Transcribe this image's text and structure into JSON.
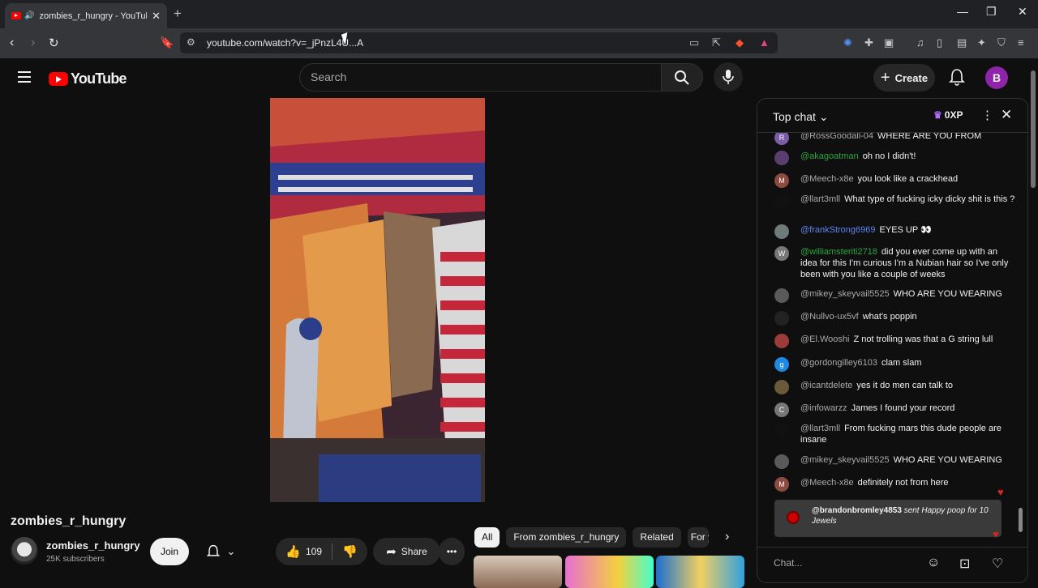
{
  "browser": {
    "tab_title": "zombies_r_hungry - YouTube",
    "url": "youtube.com/watch?v=_jPnzL4U...A"
  },
  "header": {
    "logo_text": "YouTube",
    "search_placeholder": "Search",
    "create_label": "Create",
    "avatar_letter": "B"
  },
  "video": {
    "title": "zombies_r_hungry",
    "channel_name": "zombies_r_hungry",
    "subscribers": "25K subscribers",
    "join_label": "Join",
    "likes": "109",
    "share_label": "Share"
  },
  "chips": [
    "All",
    "From zombies_r_hungry",
    "Related",
    "For y"
  ],
  "chat": {
    "header": "Top chat",
    "xp_label": "0XP",
    "input_placeholder": "Chat...",
    "messages": [
      {
        "user": "@RossGoodall-04",
        "text": "WHERE ARE YOU FROM",
        "avatar": "R",
        "avatar_color": "#7b5ca8",
        "user_color": "gray"
      },
      {
        "user": "@akagoatman",
        "text": "oh no I didn't!",
        "avatar": "",
        "avatar_color": "#5a3f6e",
        "user_color": "green"
      },
      {
        "user": "@Meech-x8e",
        "text": "you look like a crackhead",
        "avatar": "M",
        "avatar_color": "#8d4b40",
        "user_color": "gray"
      },
      {
        "user": "@llart3mll",
        "text": "What type of fucking icky dicky shit is this ?",
        "avatar": "",
        "avatar_color": "#111111",
        "user_color": "gray"
      },
      {
        "user": "@frankStrong6969",
        "text": "EYES UP 👀",
        "avatar": "",
        "avatar_color": "#6f7a7a",
        "user_color": "blue"
      },
      {
        "user": "@williamsteriti2718",
        "text": "did you ever come up with an idea for this I'm curious I'm a Nubian hair so I've only been with you like a couple of weeks",
        "avatar": "W",
        "avatar_color": "#777777",
        "user_color": "green"
      },
      {
        "user": "@mikey_skeyvail5525",
        "text": "WHO ARE YOU WEARING",
        "avatar": "",
        "avatar_color": "#5a5a5a",
        "user_color": "gray"
      },
      {
        "user": "@Nullvo-ux5vf",
        "text": "what's poppin",
        "avatar": "",
        "avatar_color": "#222222",
        "user_color": "gray"
      },
      {
        "user": "@El.Wooshi",
        "text": "Z not trolling was that a G string lull",
        "avatar": "",
        "avatar_color": "#9c3b3b",
        "user_color": "gray"
      },
      {
        "user": "@gordongilley6103",
        "text": "clam slam",
        "avatar": "g",
        "avatar_color": "#1e88e5",
        "user_color": "gray"
      },
      {
        "user": "@icantdelete",
        "text": "yes it do men can talk to",
        "avatar": "",
        "avatar_color": "#6b5a3a",
        "user_color": "gray"
      },
      {
        "user": "@infowarzz",
        "text": "James I found your record",
        "avatar": "C",
        "avatar_color": "#777777",
        "user_color": "gray"
      },
      {
        "user": "@llart3mll",
        "text": "From fucking mars this dude people are insane",
        "avatar": "",
        "avatar_color": "#111111",
        "user_color": "gray"
      },
      {
        "user": "@mikey_skeyvail5525",
        "text": "WHO ARE YOU WEARING",
        "avatar": "",
        "avatar_color": "#5a5a5a",
        "user_color": "gray"
      },
      {
        "user": "@Meech-x8e",
        "text": "definitely not from here",
        "avatar": "M",
        "avatar_color": "#8d4b40",
        "user_color": "gray"
      }
    ],
    "gift": {
      "user": "@brandonbromley4853",
      "text": "sent Happy poop for 10 Jewels"
    }
  }
}
